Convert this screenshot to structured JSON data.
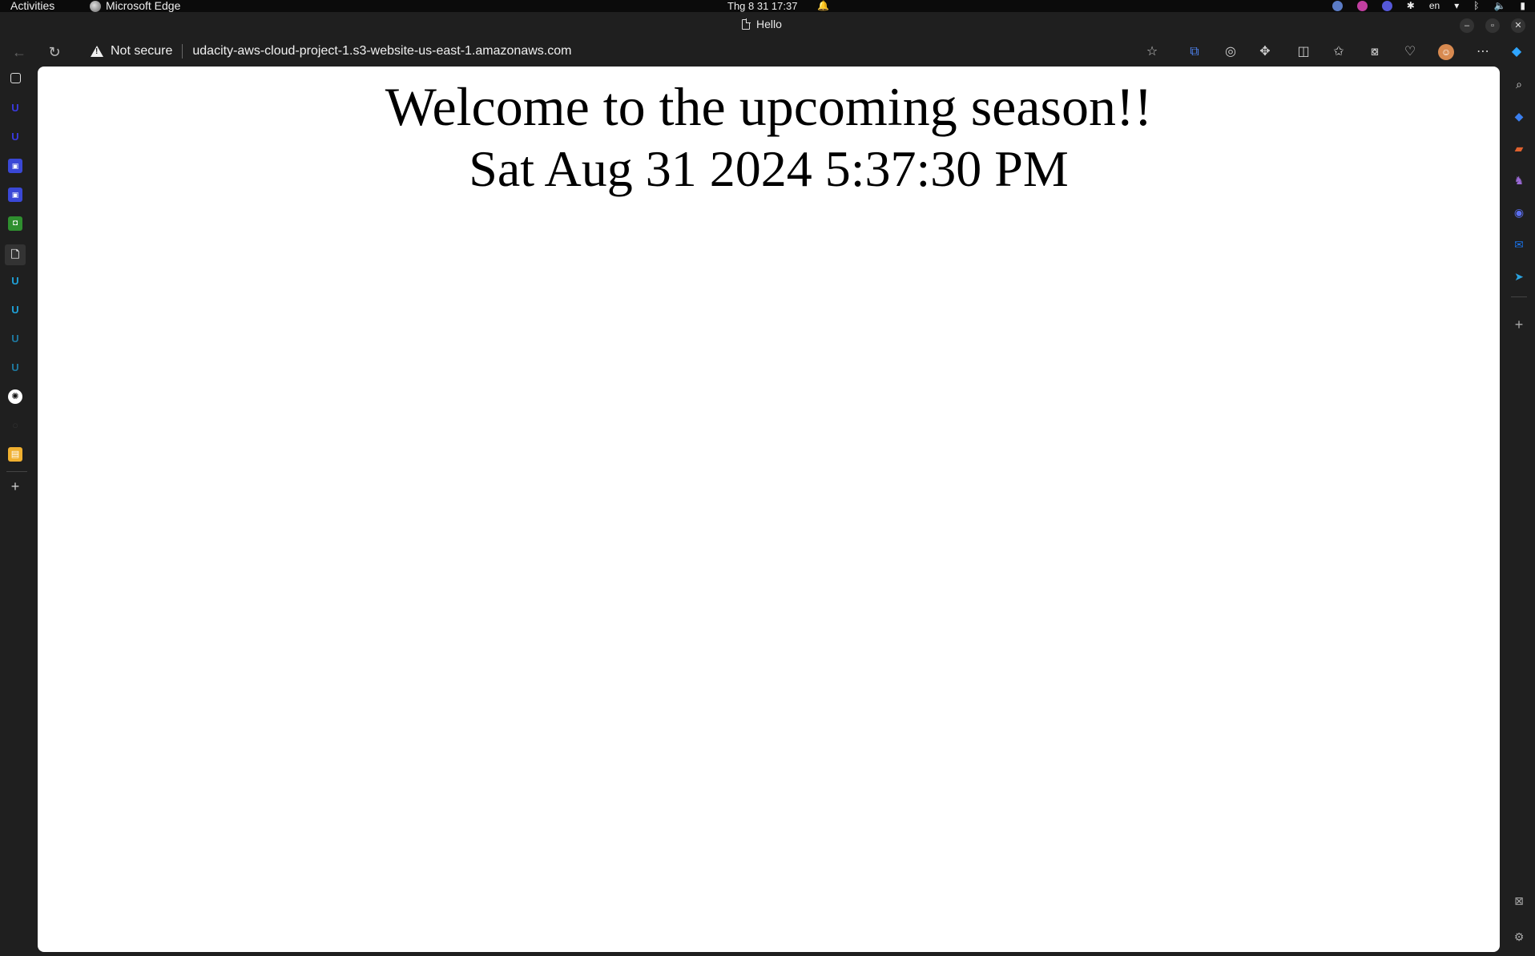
{
  "system_bar": {
    "activities": "Activities",
    "app_name": "Microsoft Edge",
    "clock": "Thg 8 31  17:37",
    "lang": "en"
  },
  "window": {
    "tab_title": "Hello"
  },
  "address_bar": {
    "security": "Not secure",
    "url": "udacity-aws-cloud-project-1.s3-website-us-east-1.amazonaws.com"
  },
  "page": {
    "heading": "Welcome to the upcoming season!!",
    "datetime": "Sat Aug 31 2024 5:37:30 PM"
  },
  "left_tabs": [
    {
      "icon": "tab-actions-icon"
    },
    {
      "icon": "udacity-icon"
    },
    {
      "icon": "udacity-icon"
    },
    {
      "icon": "app-icon"
    },
    {
      "icon": "app-icon"
    },
    {
      "icon": "green-app-icon"
    },
    {
      "icon": "document-icon"
    },
    {
      "icon": "udacity-icon"
    },
    {
      "icon": "udacity-icon"
    },
    {
      "icon": "udacity-icon"
    },
    {
      "icon": "udacity-icon"
    },
    {
      "icon": "openai-icon"
    },
    {
      "icon": "blank-icon"
    },
    {
      "icon": "aws-icon"
    },
    {
      "icon": "add-tab-icon"
    }
  ],
  "colors": {
    "chrome_bg": "#1f1f1f",
    "page_bg": "#ffffff",
    "udacity_blue": "#3a3ae0",
    "udacity_cyan": "#1fa1d8"
  }
}
